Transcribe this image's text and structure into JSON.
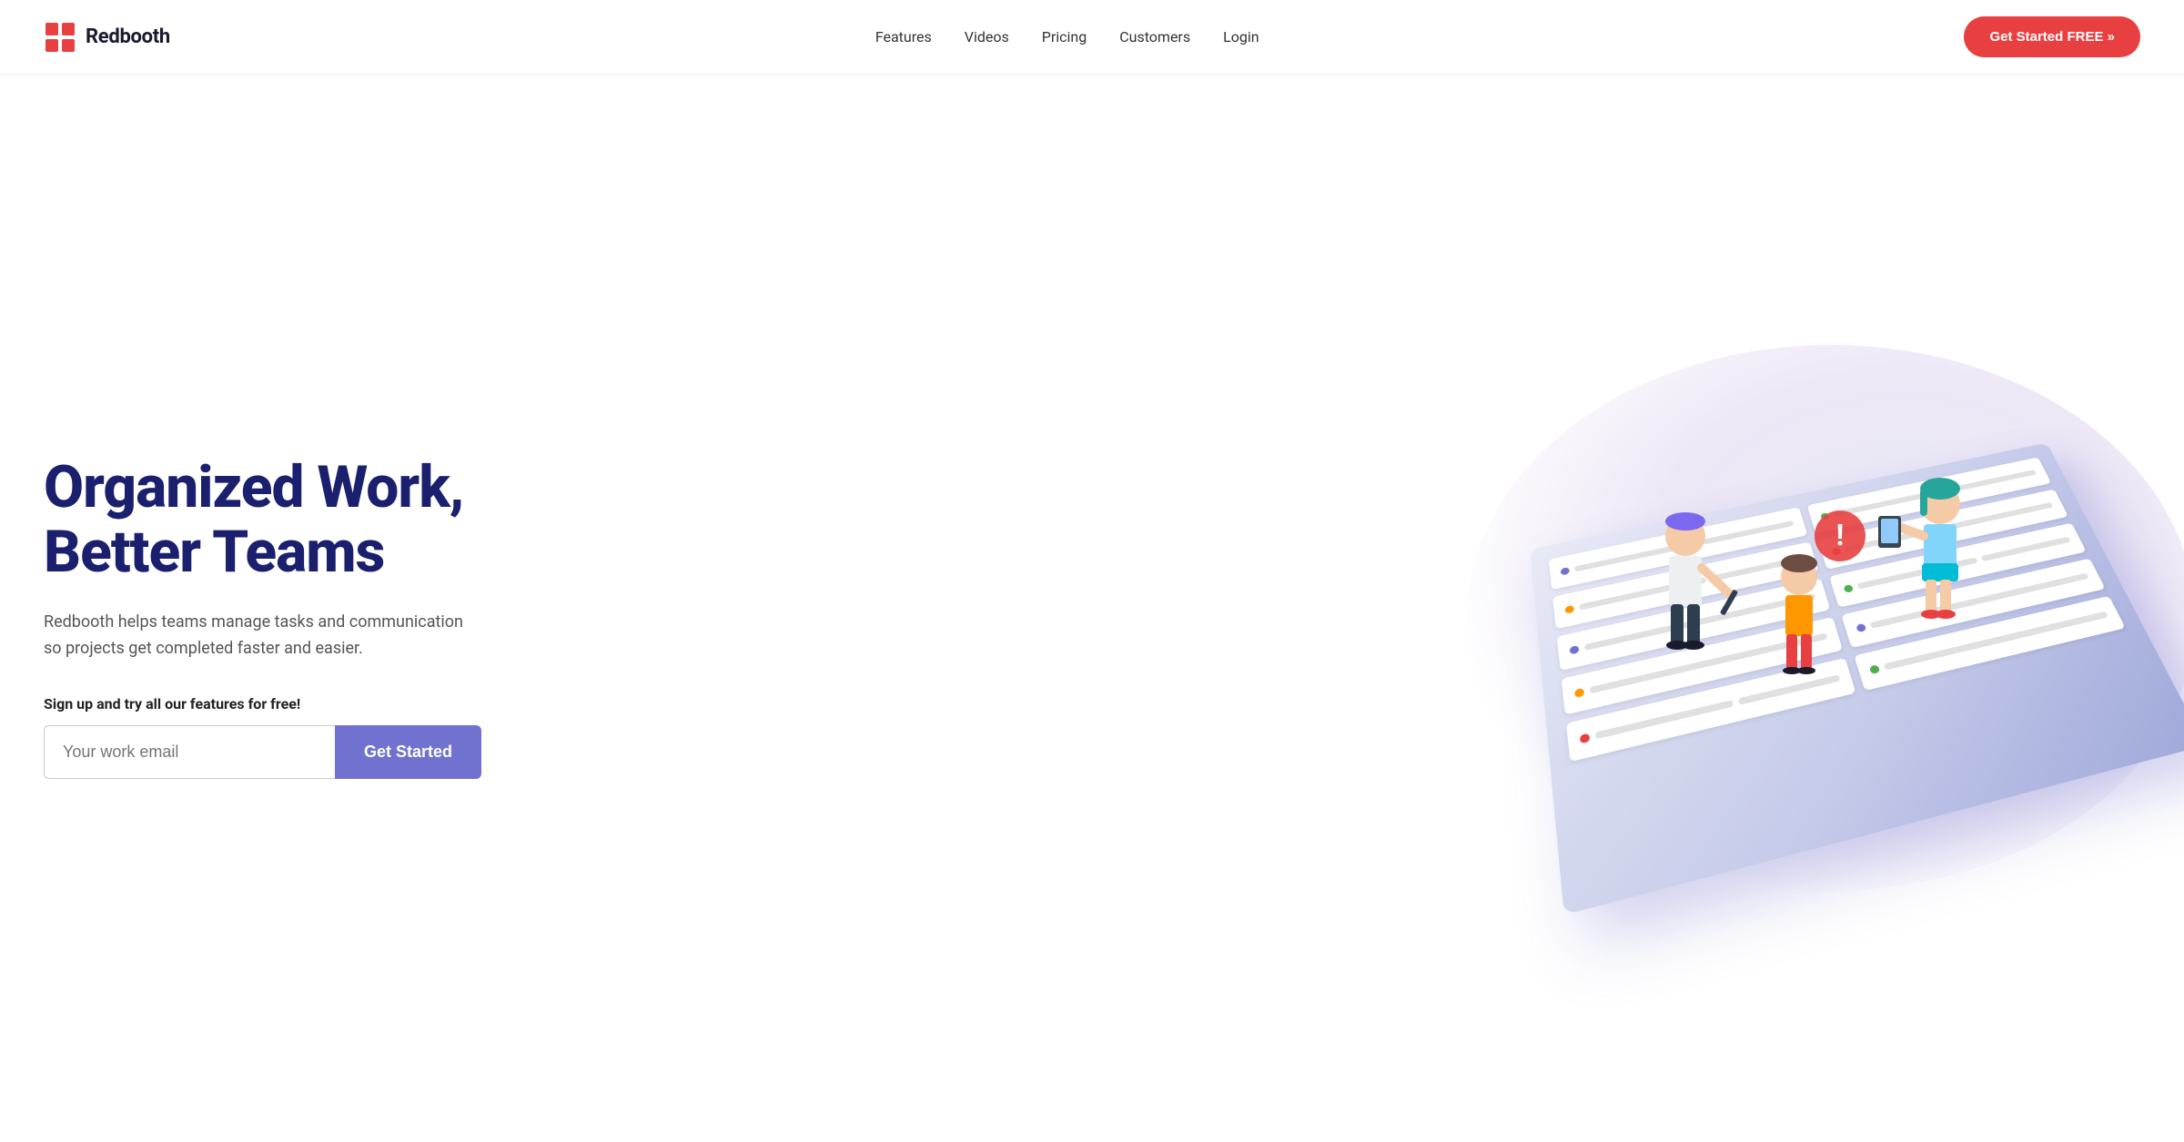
{
  "brand": {
    "name": "Redbooth",
    "logo_alt": "Redbooth logo"
  },
  "nav": {
    "links": [
      {
        "id": "features",
        "label": "Features"
      },
      {
        "id": "videos",
        "label": "Videos"
      },
      {
        "id": "pricing",
        "label": "Pricing"
      },
      {
        "id": "customers",
        "label": "Customers"
      },
      {
        "id": "login",
        "label": "Login"
      }
    ],
    "cta_label": "Get Started FREE »"
  },
  "hero": {
    "title_line1": "Organized Work,",
    "title_line2": "Better Teams",
    "subtitle": "Redbooth helps teams manage tasks and communication so projects get completed faster and easier.",
    "signup_label": "Sign up and try all our features for free!",
    "email_placeholder": "Your work email",
    "get_started_label": "Get Started"
  },
  "colors": {
    "brand_red": "#e84040",
    "brand_navy": "#1a1f6e",
    "brand_purple": "#7171d0",
    "nav_link": "#333333"
  }
}
